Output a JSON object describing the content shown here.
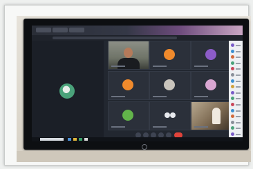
{
  "photo": {
    "subject": "video-conference-on-monitor",
    "colors": {
      "frame": "#f7f8f7",
      "screen_bg": "#222730",
      "tile_bg": "#2b303a",
      "end_call": "#e0433a",
      "big_avatar": "#4aa27a"
    }
  },
  "meeting": {
    "tiles": [
      {
        "kind": "camera",
        "avatar_color": "#b47a5a"
      },
      {
        "kind": "avatar",
        "avatar_color": "#f08a2c"
      },
      {
        "kind": "avatar",
        "avatar_color": "#8c5cc8"
      },
      {
        "kind": "avatar",
        "avatar_color": "#f08a2c"
      },
      {
        "kind": "avatar",
        "avatar_color": "#c9c4bc"
      },
      {
        "kind": "avatar",
        "avatar_color": "#d9a6d2"
      },
      {
        "kind": "avatar",
        "avatar_color": "#62b34a"
      },
      {
        "kind": "dots",
        "avatar_color": "#e7e9ee"
      },
      {
        "kind": "camera-room",
        "avatar_color": "#f0e9df"
      }
    ],
    "participant_dot_colors": [
      "#7a5cc8",
      "#3b8fd0",
      "#d0693b",
      "#4aa27a",
      "#c9465a",
      "#8a8f99",
      "#3b8fd0",
      "#d0a13b",
      "#7a5cc8",
      "#4aa27a",
      "#c9465a",
      "#3b8fd0",
      "#d0693b",
      "#8a8f99",
      "#4aa27a",
      "#7a5cc8"
    ]
  }
}
